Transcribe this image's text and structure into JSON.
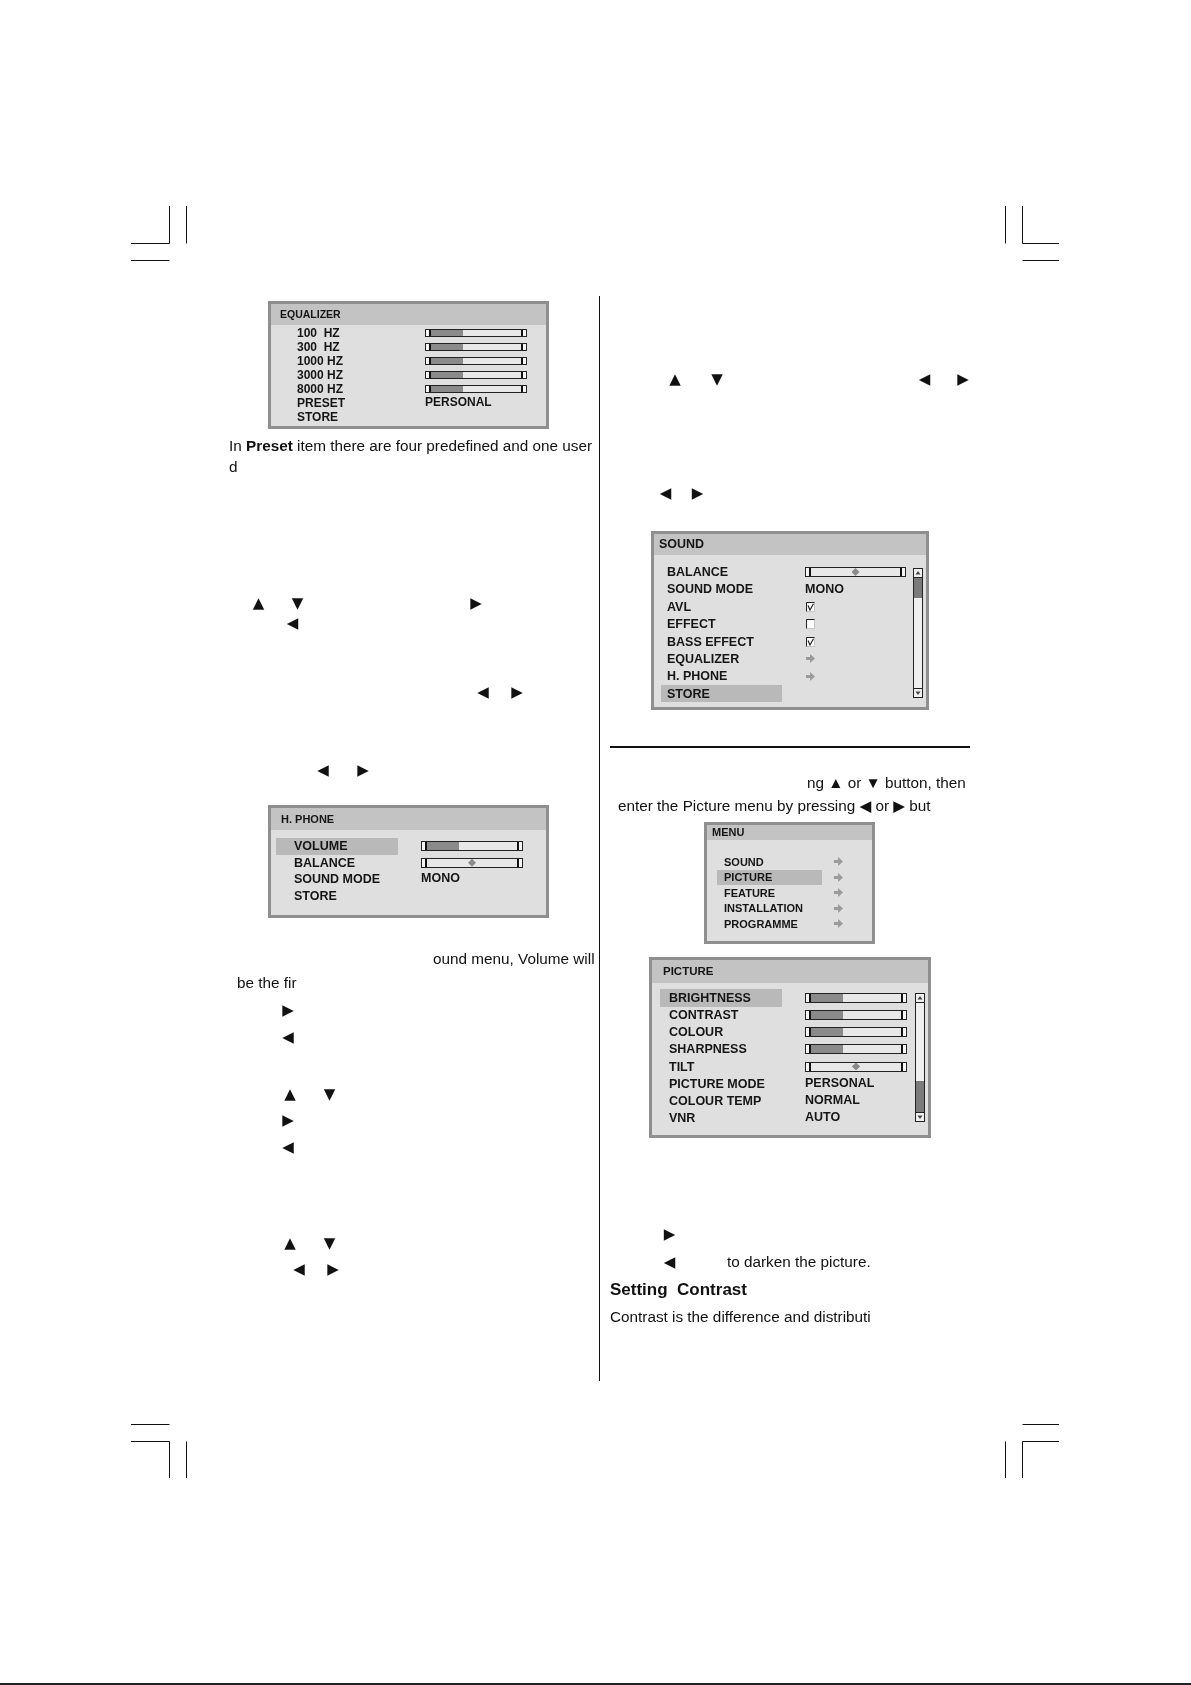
{
  "left_column": [
    {
      "kind": "menu",
      "title": "EQUALIZER",
      "items": [
        {
          "label": "100  HZ",
          "kind": "slider",
          "level": 0.35,
          "selected": false
        },
        {
          "label": "300  HZ",
          "kind": "slider",
          "level": 0.35,
          "selected": false
        },
        {
          "label": "1000 HZ",
          "kind": "slider",
          "level": 0.35,
          "selected": false
        },
        {
          "label": "3000 HZ",
          "kind": "slider",
          "level": 0.35,
          "selected": false
        },
        {
          "label": "8000 HZ",
          "kind": "slider",
          "level": 0.35,
          "selected": false
        },
        {
          "label": "PRESET",
          "kind": "value",
          "value": "PERSONAL",
          "selected": false
        },
        {
          "label": "STORE",
          "kind": "plain",
          "selected": false
        }
      ]
    },
    {
      "kind": "text",
      "text": "In **Preset** item there are four predefined and one user d"
    },
    {
      "kind": "arrows",
      "glyphs": [
        "▲",
        "▼",
        "▶"
      ]
    },
    {
      "kind": "arrows",
      "glyphs": [
        "◀"
      ]
    },
    {
      "kind": "arrows",
      "glyphs": [
        "◀",
        "▶"
      ]
    },
    {
      "kind": "arrows",
      "glyphs": [
        "◀",
        "▶"
      ]
    },
    {
      "kind": "menu",
      "title": "H. PHONE",
      "items": [
        {
          "label": "VOLUME",
          "kind": "slider",
          "level": 0.35,
          "selected": true
        },
        {
          "label": "BALANCE",
          "kind": "balance",
          "level": 0.5,
          "selected": false
        },
        {
          "label": "SOUND MODE",
          "kind": "value",
          "value": "MONO",
          "selected": false
        },
        {
          "label": "STORE",
          "kind": "plain",
          "selected": false
        }
      ]
    },
    {
      "kind": "text",
      "text": "ound menu, Volume will be the fir"
    },
    {
      "kind": "arrows",
      "glyphs": [
        "▶"
      ]
    },
    {
      "kind": "arrows",
      "glyphs": [
        "◀"
      ]
    },
    {
      "kind": "arrows",
      "glyphs": [
        "▲",
        "▼"
      ]
    },
    {
      "kind": "arrows",
      "glyphs": [
        "▶"
      ]
    },
    {
      "kind": "arrows",
      "glyphs": [
        "◀"
      ]
    },
    {
      "kind": "arrows",
      "glyphs": [
        "▲",
        "▼"
      ]
    },
    {
      "kind": "arrows",
      "glyphs": [
        "◀",
        "▶"
      ]
    }
  ],
  "right_column": [
    {
      "kind": "arrows",
      "glyphs": [
        "▲",
        "▼",
        "◀",
        "▶"
      ]
    },
    {
      "kind": "arrows",
      "glyphs": [
        "◀",
        "▶"
      ]
    },
    {
      "kind": "menu",
      "title": "SOUND",
      "scrollbar": true,
      "items": [
        {
          "label": "BALANCE",
          "kind": "balance",
          "level": 0.5,
          "selected": false
        },
        {
          "label": "SOUND MODE",
          "kind": "value",
          "value": "MONO",
          "selected": false
        },
        {
          "label": "AVL",
          "kind": "checkbox",
          "checked": true,
          "selected": false
        },
        {
          "label": "EFFECT",
          "kind": "checkbox",
          "checked": false,
          "selected": false
        },
        {
          "label": "BASS EFFECT",
          "kind": "checkbox",
          "checked": true,
          "selected": false
        },
        {
          "label": "EQUALIZER",
          "kind": "submenu",
          "selected": false
        },
        {
          "label": "H. PHONE",
          "kind": "submenu",
          "selected": false
        },
        {
          "label": "STORE",
          "kind": "plain",
          "selected": true
        }
      ]
    },
    {
      "kind": "rule"
    },
    {
      "kind": "text",
      "text": "ng ▲ or ▼ button, then enter the Picture menu by pressing ◀ or ▶ but"
    },
    {
      "kind": "menu",
      "title": "MENU",
      "items": [
        {
          "label": "SOUND",
          "kind": "submenu",
          "selected": false
        },
        {
          "label": "PICTURE",
          "kind": "submenu",
          "selected": true
        },
        {
          "label": "FEATURE",
          "kind": "submenu",
          "selected": false
        },
        {
          "label": "INSTALLATION",
          "kind": "submenu",
          "selected": false
        },
        {
          "label": "PROGRAMME",
          "kind": "submenu",
          "selected": false
        }
      ]
    },
    {
      "kind": "menu",
      "title": "PICTURE",
      "scrollbar": true,
      "items": [
        {
          "label": "BRIGHTNESS",
          "kind": "slider",
          "level": 0.35,
          "selected": true
        },
        {
          "label": "CONTRAST",
          "kind": "slider",
          "level": 0.35,
          "selected": false
        },
        {
          "label": "COLOUR",
          "kind": "slider",
          "level": 0.35,
          "selected": false
        },
        {
          "label": "SHARPNESS",
          "kind": "slider",
          "level": 0.35,
          "selected": false
        },
        {
          "label": "TILT",
          "kind": "balance",
          "level": 0.5,
          "selected": false
        },
        {
          "label": "PICTURE MODE",
          "kind": "value",
          "value": "PERSONAL",
          "selected": false
        },
        {
          "label": "COLOUR TEMP",
          "kind": "value",
          "value": "NORMAL",
          "selected": false
        },
        {
          "label": "VNR",
          "kind": "value",
          "value": "AUTO",
          "selected": false
        }
      ]
    },
    {
      "kind": "arrows",
      "glyphs": [
        "▶"
      ]
    },
    {
      "kind": "arrows",
      "glyphs": [
        "◀"
      ],
      "text": "to darken the picture."
    },
    {
      "kind": "heading",
      "text": "Setting  Contrast"
    },
    {
      "kind": "text",
      "text": "Contrast is the difference and distributi"
    }
  ]
}
